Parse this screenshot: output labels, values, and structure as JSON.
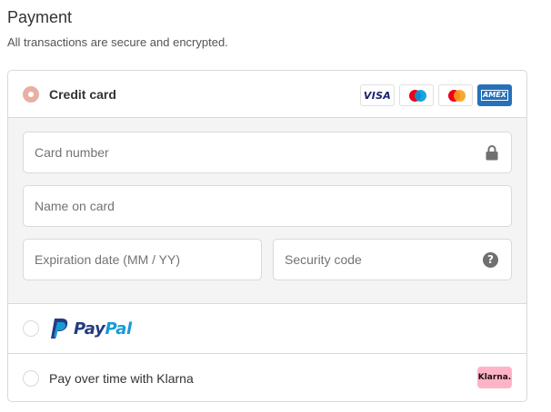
{
  "header": {
    "title": "Payment",
    "subtitle": "All transactions are secure and encrypted."
  },
  "options": {
    "credit_card": {
      "label": "Credit card",
      "selected": true,
      "card_logos": [
        {
          "name": "visa",
          "text": "VISA"
        },
        {
          "name": "maestro",
          "colors": [
            "#eb001b",
            "#0099df"
          ]
        },
        {
          "name": "mastercard",
          "colors": [
            "#eb001b",
            "#f79e1b"
          ]
        },
        {
          "name": "amex",
          "text": "AMEX"
        }
      ]
    },
    "paypal": {
      "label_dark": "Pay",
      "label_light": "Pal",
      "selected": false
    },
    "klarna": {
      "label": "Pay over time with Klarna",
      "badge": "Klarna.",
      "selected": false
    }
  },
  "card_form": {
    "card_number": {
      "placeholder": "Card number",
      "value": ""
    },
    "name_on_card": {
      "placeholder": "Name on card",
      "value": ""
    },
    "expiration": {
      "placeholder": "Expiration date (MM / YY)",
      "value": ""
    },
    "security_code": {
      "placeholder": "Security code",
      "value": ""
    }
  },
  "icons": {
    "lock": "lock-icon",
    "help": "help-circle-icon"
  },
  "colors": {
    "accent_radio": "#e7b0a3",
    "border": "#d9d9d9",
    "form_bg": "#f4f4f4",
    "paypal_dark": "#253b80",
    "paypal_light": "#179bd7",
    "klarna_pink": "#ffb3c7",
    "amex_blue": "#2671b9"
  }
}
